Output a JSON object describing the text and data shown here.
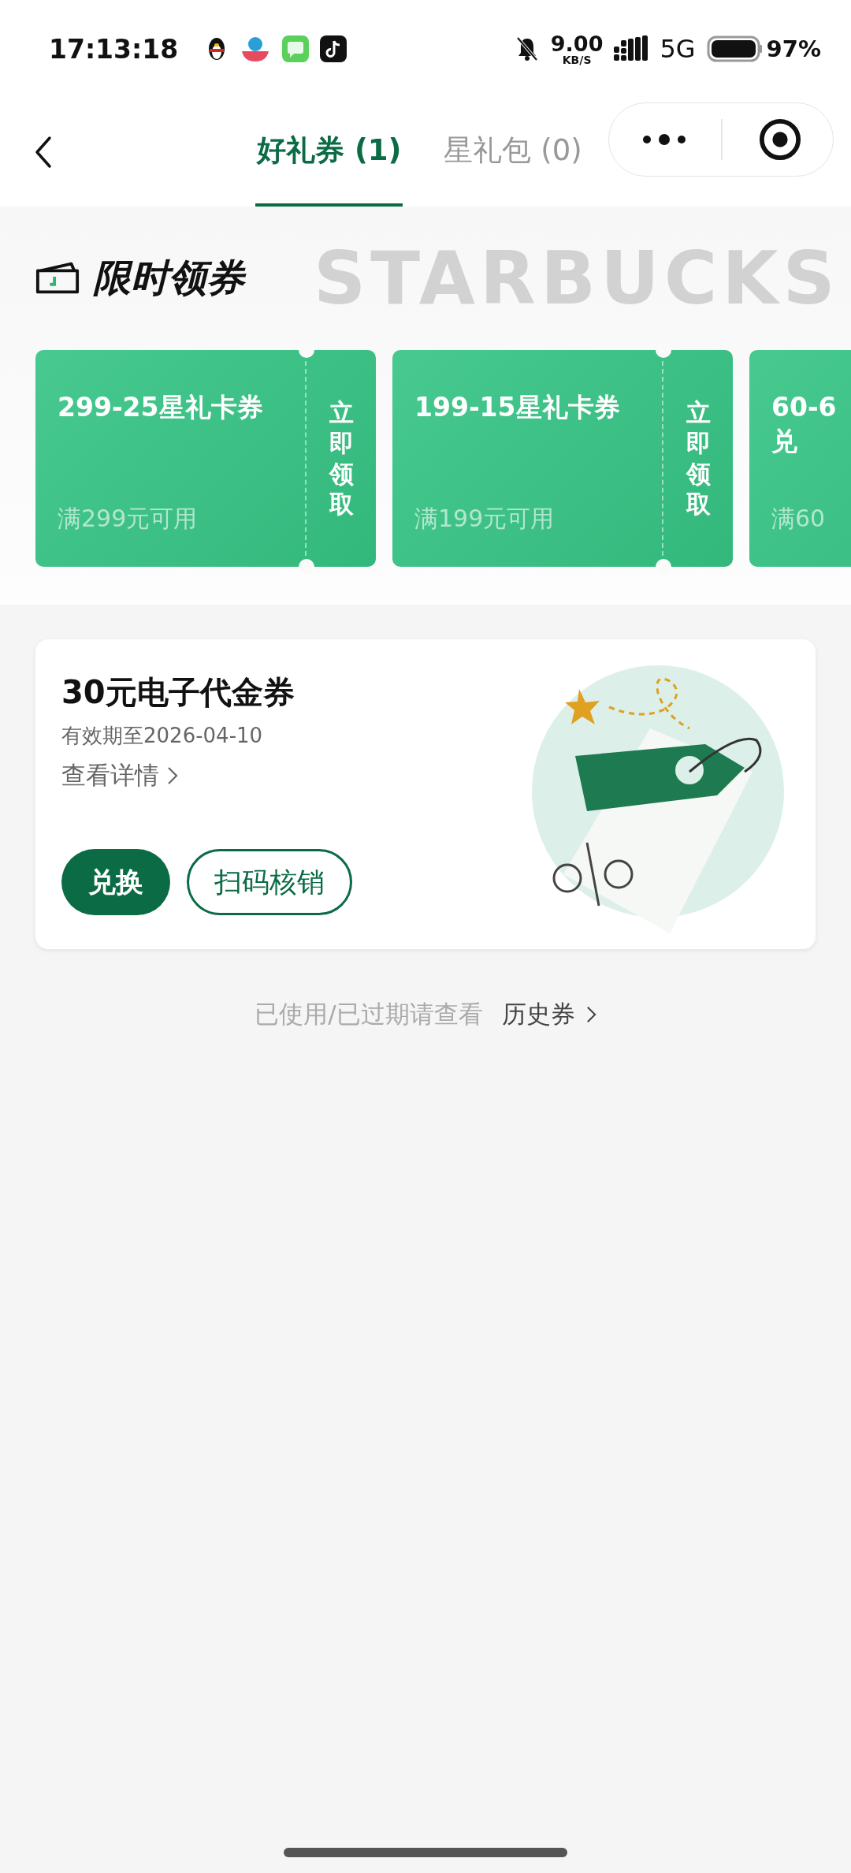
{
  "status_bar": {
    "time": "17:13:18",
    "net_speed": "9.00",
    "net_unit": "KB/S",
    "network": "5G",
    "battery": "97%"
  },
  "nav": {
    "tabs": [
      {
        "label": "好礼券 (1)",
        "selected": true
      },
      {
        "label": "星礼包 (0)",
        "selected": false
      }
    ]
  },
  "promo": {
    "title": "限时领券",
    "backdrop": "STARBUCKS",
    "coupons": [
      {
        "title": "299-25星礼卡券",
        "condition": "满299元可用",
        "action": "立即领取"
      },
      {
        "title": "199-15星礼卡券",
        "condition": "满199元可用",
        "action": "立即领取"
      },
      {
        "title": "60-6\n兑",
        "condition": "满60"
      }
    ]
  },
  "voucher": {
    "title": "30元电子代金券",
    "expiry": "有效期至2026-04-10",
    "details_link": "查看详情",
    "buttons": [
      {
        "label": "兑换",
        "kind": "primary"
      },
      {
        "label": "扫码核销",
        "kind": "outline"
      }
    ]
  },
  "history": {
    "hint": "已使用/已过期请查看",
    "link": "历史券"
  }
}
